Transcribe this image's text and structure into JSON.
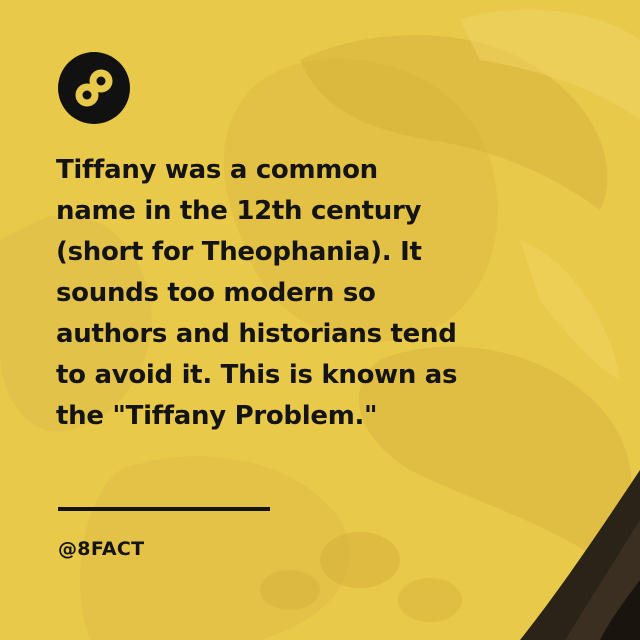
{
  "fact": {
    "lines": [
      "Tiffany was a common",
      "name in the 12th century",
      "(short for Theophania). It",
      "sounds too modern so",
      "authors and historians tend",
      "to avoid it. This is known as",
      "the \"Tiffany Problem.\""
    ]
  },
  "footer": {
    "handle": "@8FACT"
  },
  "logo": {
    "icon": "infinity-8-icon"
  },
  "colors": {
    "background": "#e9c94a",
    "text": "#141414",
    "logo_bg": "#111111",
    "logo_mark": "#e9c94a"
  }
}
